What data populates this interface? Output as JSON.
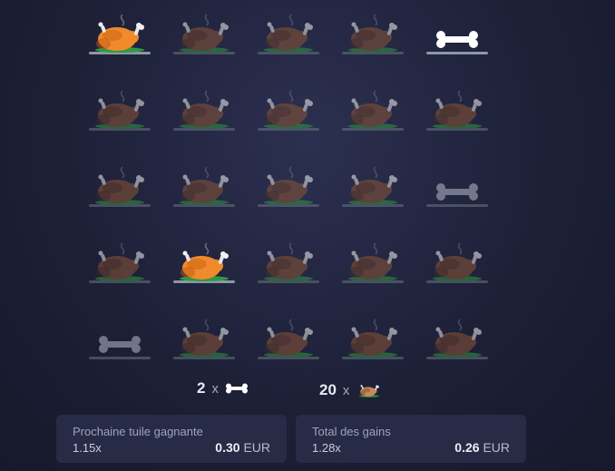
{
  "tiles": [
    [
      "turkey-revealed",
      "turkey",
      "turkey",
      "turkey",
      "bone-revealed"
    ],
    [
      "turkey",
      "turkey",
      "turkey",
      "turkey",
      "turkey"
    ],
    [
      "turkey",
      "turkey",
      "turkey",
      "turkey",
      "bone"
    ],
    [
      "turkey",
      "turkey-revealed",
      "turkey",
      "turkey",
      "turkey"
    ],
    [
      "bone",
      "turkey",
      "turkey",
      "turkey",
      "turkey"
    ]
  ],
  "summary": {
    "bones_count": "2",
    "bones_x": "x",
    "turkeys_count": "20",
    "turkeys_x": "x"
  },
  "next_tile": {
    "title": "Prochaine tuile gagnante",
    "multiplier": "1.15x",
    "amount": "0.30",
    "currency": "EUR"
  },
  "total": {
    "title": "Total des gains",
    "multiplier": "1.28x",
    "amount": "0.26",
    "currency": "EUR"
  },
  "colors": {
    "turkey_bright": "#f08a2c",
    "turkey_dark": "#8c5636",
    "bone": "#ffffff",
    "panel_bg": "#272b45"
  }
}
